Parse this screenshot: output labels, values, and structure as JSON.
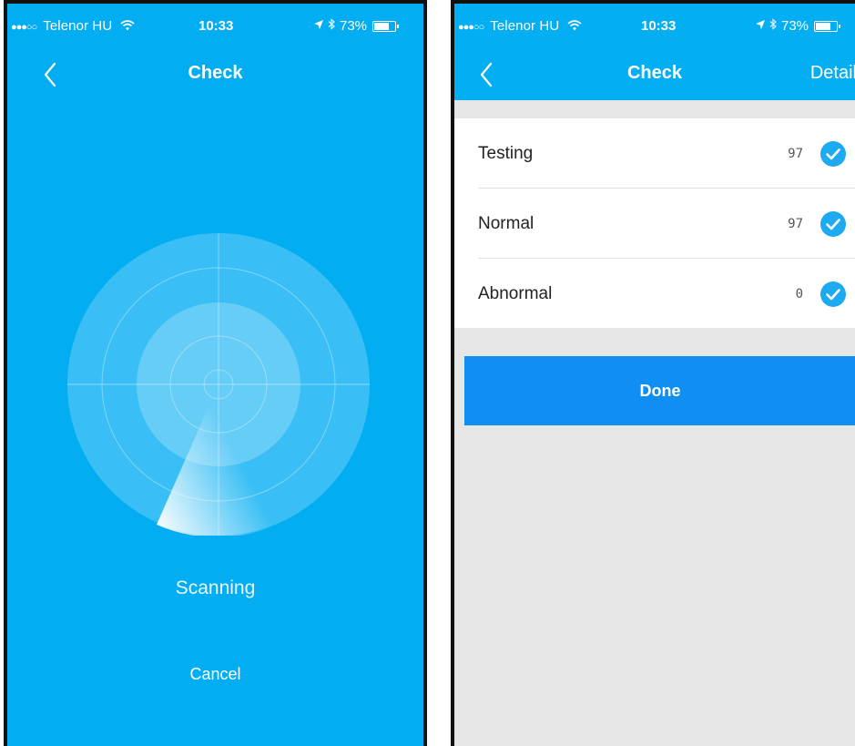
{
  "colors": {
    "primary_blue": "#02adf2",
    "done_button_blue": "#0f8ff2",
    "check_blue": "#1eaaf1",
    "right_background": "#e6e6e6"
  },
  "left_screen": {
    "status_bar": {
      "carrier": "Telenor HU",
      "time": "10:33",
      "battery": "73%"
    },
    "nav": {
      "back_icon": "chevron-left-icon",
      "title": "Check"
    },
    "radar_icon": "radar-scan-icon",
    "scanning_label": "Scanning",
    "cancel_label": "Cancel"
  },
  "right_screen": {
    "status_bar": {
      "carrier": "Telenor HU",
      "time": "10:33",
      "battery": "73%"
    },
    "nav": {
      "back_icon": "chevron-left-icon",
      "title": "Check",
      "detail_label": "Detail"
    },
    "items": [
      {
        "label": "Testing",
        "count": "97",
        "icon": "check-circle-icon"
      },
      {
        "label": "Normal",
        "count": "97",
        "icon": "check-circle-icon"
      },
      {
        "label": "Abnormal",
        "count": "0",
        "icon": "check-circle-icon"
      }
    ],
    "done_label": "Done"
  }
}
